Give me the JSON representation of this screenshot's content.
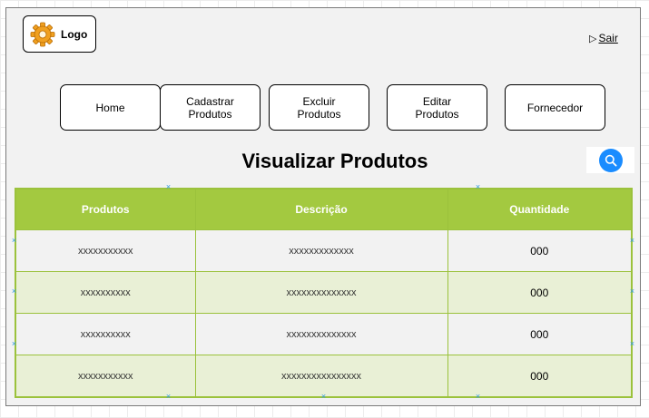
{
  "header": {
    "logo_label": "Logo",
    "exit_icon": "▷",
    "exit_label": "Sair"
  },
  "nav": {
    "items": [
      "Home",
      "Cadastrar\nProdutos",
      "Excluir\nProdutos",
      "Editar\nProdutos",
      "Fornecedor"
    ]
  },
  "page": {
    "title": "Visualizar Produtos"
  },
  "search": {
    "icon": "search-icon",
    "color": "#1a8cff"
  },
  "table": {
    "headers": [
      "Produtos",
      "Descrição",
      "Quantidade"
    ],
    "rows": [
      [
        "xxxxxxxxxxx",
        "xxxxxxxxxxxxx",
        "000"
      ],
      [
        "xxxxxxxxxx",
        "xxxxxxxxxxxxxx",
        "000"
      ],
      [
        "xxxxxxxxxx",
        "xxxxxxxxxxxxxx",
        "000"
      ],
      [
        "xxxxxxxxxxx",
        "xxxxxxxxxxxxxxxx",
        "000"
      ]
    ],
    "header_color": "#a3c940",
    "alt_row_color": "#e9f0d6",
    "border_color": "#9bc23c"
  }
}
